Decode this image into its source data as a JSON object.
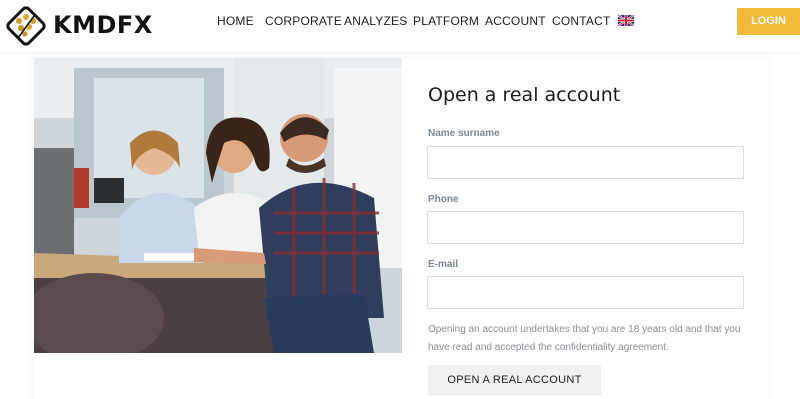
{
  "header": {
    "brand": "KMDFX",
    "nav": [
      {
        "label": "HOME"
      },
      {
        "label": "CORPORATE"
      },
      {
        "label": "ANALYZES"
      },
      {
        "label": "PLATFORM"
      },
      {
        "label": "ACCOUNT"
      },
      {
        "label": "CONTACT"
      }
    ],
    "language_icon": "uk-flag-icon",
    "login_label": "LOGIN",
    "login_color": "#f2b93b"
  },
  "form": {
    "title": "Open a real account",
    "fields": [
      {
        "label": "Name surname",
        "value": ""
      },
      {
        "label": "Phone",
        "value": ""
      },
      {
        "label": "E-mail",
        "value": ""
      }
    ],
    "terms": "Opening an account undertakes that you are 18 years old and that you have read and accepted the confidentiality agreement.",
    "submit_label": "OPEN A REAL ACCOUNT"
  }
}
